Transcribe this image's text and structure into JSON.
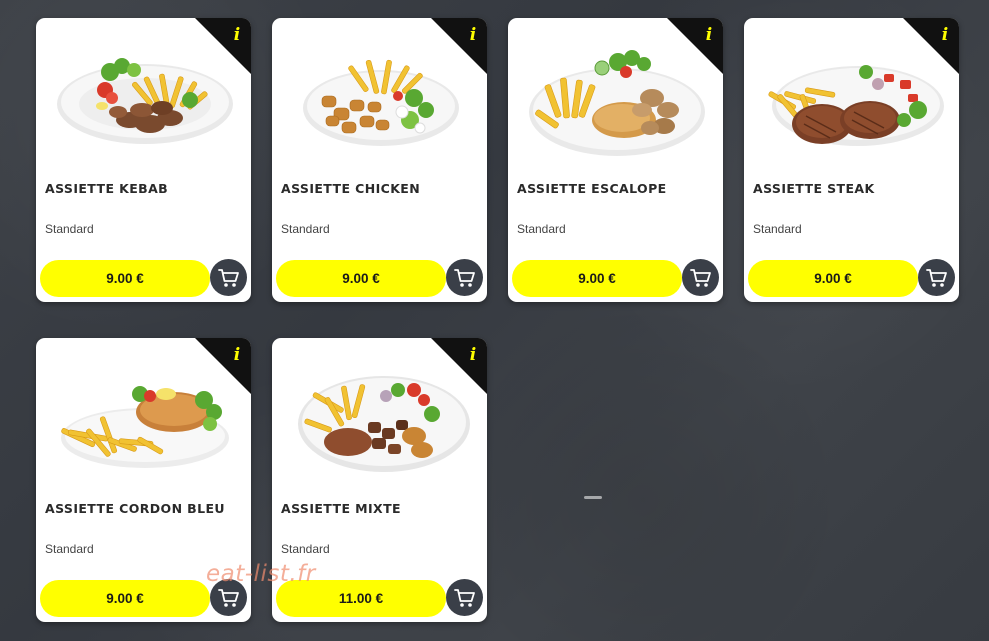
{
  "menu": {
    "items": [
      {
        "name": "ASSIETTE KEBAB",
        "variant": "Standard",
        "price": "9.00 €",
        "info_icon": "info-icon",
        "cart_icon": "cart-icon"
      },
      {
        "name": "ASSIETTE CHICKEN",
        "variant": "Standard",
        "price": "9.00 €",
        "info_icon": "info-icon",
        "cart_icon": "cart-icon"
      },
      {
        "name": "ASSIETTE ESCALOPE",
        "variant": "Standard",
        "price": "9.00 €",
        "info_icon": "info-icon",
        "cart_icon": "cart-icon"
      },
      {
        "name": "ASSIETTE STEAK",
        "variant": "Standard",
        "price": "9.00 €",
        "info_icon": "info-icon",
        "cart_icon": "cart-icon"
      },
      {
        "name": "ASSIETTE CORDON BLEU",
        "variant": "Standard",
        "price": "9.00 €",
        "info_icon": "info-icon",
        "cart_icon": "cart-icon"
      },
      {
        "name": "ASSIETTE MIXTE",
        "variant": "Standard",
        "price": "11.00 €",
        "info_icon": "info-icon",
        "cart_icon": "cart-icon"
      }
    ]
  },
  "watermark": "eat-list.fr",
  "colors": {
    "accent": "#ffff00",
    "cart_button": "#3a3f48",
    "background": "#3b3f44",
    "card": "#ffffff",
    "info_corner": "#111111"
  }
}
